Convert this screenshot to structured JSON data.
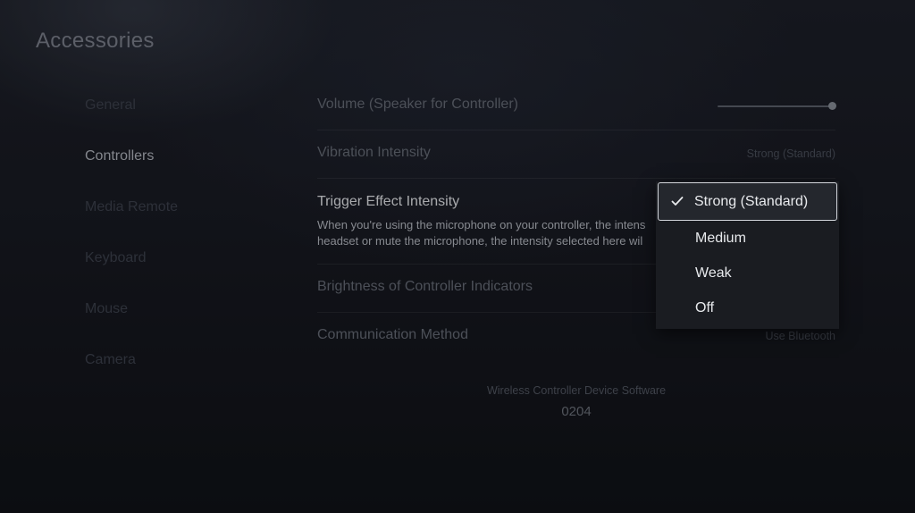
{
  "page": {
    "title": "Accessories"
  },
  "sidebar": {
    "items": [
      {
        "label": "General",
        "active": false
      },
      {
        "label": "Controllers",
        "active": true
      },
      {
        "label": "Media Remote",
        "active": false
      },
      {
        "label": "Keyboard",
        "active": false
      },
      {
        "label": "Mouse",
        "active": false
      },
      {
        "label": "Camera",
        "active": false
      }
    ]
  },
  "settings": {
    "volume": {
      "label": "Volume (Speaker for Controller)",
      "level": 1.0
    },
    "vibration": {
      "label": "Vibration Intensity",
      "value": "Strong (Standard)"
    },
    "trigger": {
      "label": "Trigger Effect Intensity",
      "description_line1": "When you're using the microphone on your controller, the intens",
      "description_line2": "headset or mute the microphone, the intensity selected here wil"
    },
    "brightness": {
      "label": "Brightness of Controller Indicators"
    },
    "communication": {
      "label": "Communication Method",
      "value": "Use Bluetooth"
    }
  },
  "footer": {
    "label": "Wireless Controller Device Software",
    "value": "0204"
  },
  "dropdown": {
    "options": [
      {
        "label": "Strong (Standard)",
        "selected": true
      },
      {
        "label": "Medium",
        "selected": false
      },
      {
        "label": "Weak",
        "selected": false
      },
      {
        "label": "Off",
        "selected": false
      }
    ],
    "check_icon": "checkmark-icon"
  },
  "colors": {
    "background": "#131519",
    "active_text": "#e6e8eb",
    "dim_text": "#3c414b",
    "dropdown_bg": "#1a1c21",
    "focus_border": "#d3d6db"
  }
}
